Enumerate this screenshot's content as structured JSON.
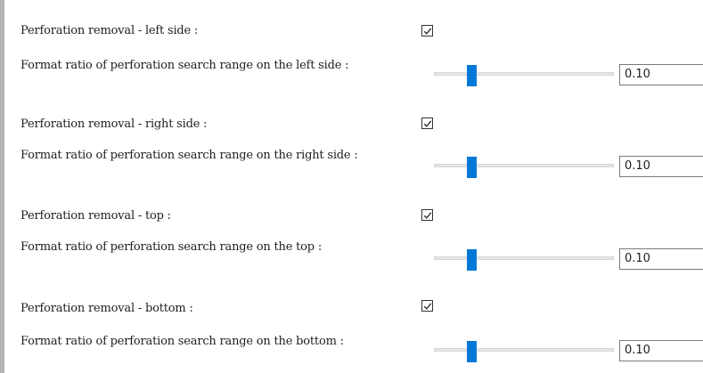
{
  "settings": [
    {
      "checkbox_label": "Perforation removal  -  left side  :",
      "checked": true,
      "ratio_label": "Format ratio of perforation search range on the left side  :",
      "value": "0.10",
      "slider_level": 0.1
    },
    {
      "checkbox_label": "Perforation removal  -  right side  :",
      "checked": true,
      "ratio_label": "Format ratio of perforation search range on the right side  :",
      "value": "0.10",
      "slider_level": 0.1
    },
    {
      "checkbox_label": "Perforation removal  -  top  :",
      "checked": true,
      "ratio_label": "Format ratio of perforation search range on the top  :",
      "value": "0.10",
      "slider_level": 0.1
    },
    {
      "checkbox_label": "Perforation removal  -  bottom :",
      "checked": true,
      "ratio_label": "Format ratio of perforation search range on the bottom  :",
      "value": "0.10",
      "slider_level": 0.1
    }
  ],
  "colors": {
    "accent": "#0078d7",
    "track": "#e7e7e7",
    "border": "#7a7a7a"
  },
  "icons": {
    "checkbox": "check-icon"
  }
}
